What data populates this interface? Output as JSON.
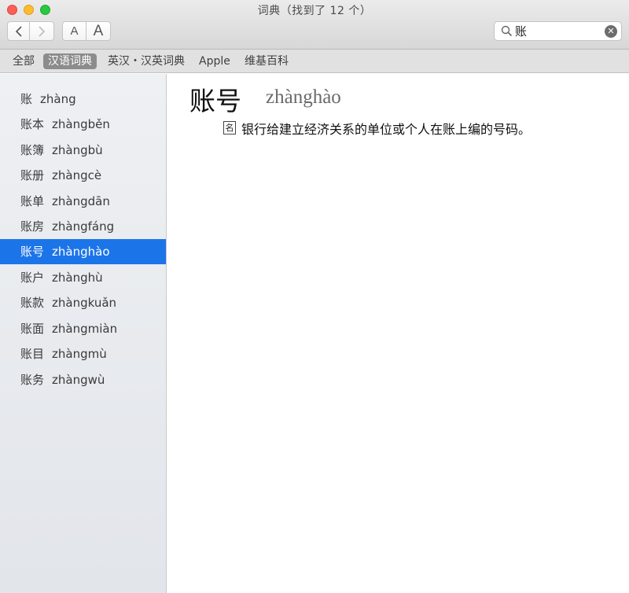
{
  "window": {
    "title": "词典（找到了 12 个）"
  },
  "toolbar": {
    "back_icon": "chevron-left",
    "forward_icon": "chevron-right",
    "font_smaller_label": "A",
    "font_larger_label": "A",
    "search": {
      "value": "账",
      "placeholder": ""
    }
  },
  "scope": {
    "items": [
      {
        "label": "全部"
      },
      {
        "label": "汉语词典"
      },
      {
        "label": "英汉・汉英词典"
      },
      {
        "label": "Apple"
      },
      {
        "label": "维基百科"
      }
    ],
    "active": "汉语词典"
  },
  "sidebar": {
    "items": [
      {
        "hanzi": "账",
        "pinyin": "zhàng"
      },
      {
        "hanzi": "账本",
        "pinyin": "zhàngběn"
      },
      {
        "hanzi": "账簿",
        "pinyin": "zhàngbù"
      },
      {
        "hanzi": "账册",
        "pinyin": "zhàngcè"
      },
      {
        "hanzi": "账单",
        "pinyin": "zhàngdān"
      },
      {
        "hanzi": "账房",
        "pinyin": "zhàngfáng"
      },
      {
        "hanzi": "账号",
        "pinyin": "zhànghào"
      },
      {
        "hanzi": "账户",
        "pinyin": "zhànghù"
      },
      {
        "hanzi": "账款",
        "pinyin": "zhàngkuǎn"
      },
      {
        "hanzi": "账面",
        "pinyin": "zhàngmiàn"
      },
      {
        "hanzi": "账目",
        "pinyin": "zhàngmù"
      },
      {
        "hanzi": "账务",
        "pinyin": "zhàngwù"
      }
    ],
    "selected": "账号"
  },
  "entry": {
    "headword": "账号",
    "pinyin": "zhànghào",
    "pos": "名",
    "definition": "银行给建立经济关系的单位或个人在账上编的号码。"
  },
  "colors": {
    "selection": "#1c74e9",
    "scope_active": "#8d8c8d",
    "sidebar_bg": "#eef0f3"
  }
}
